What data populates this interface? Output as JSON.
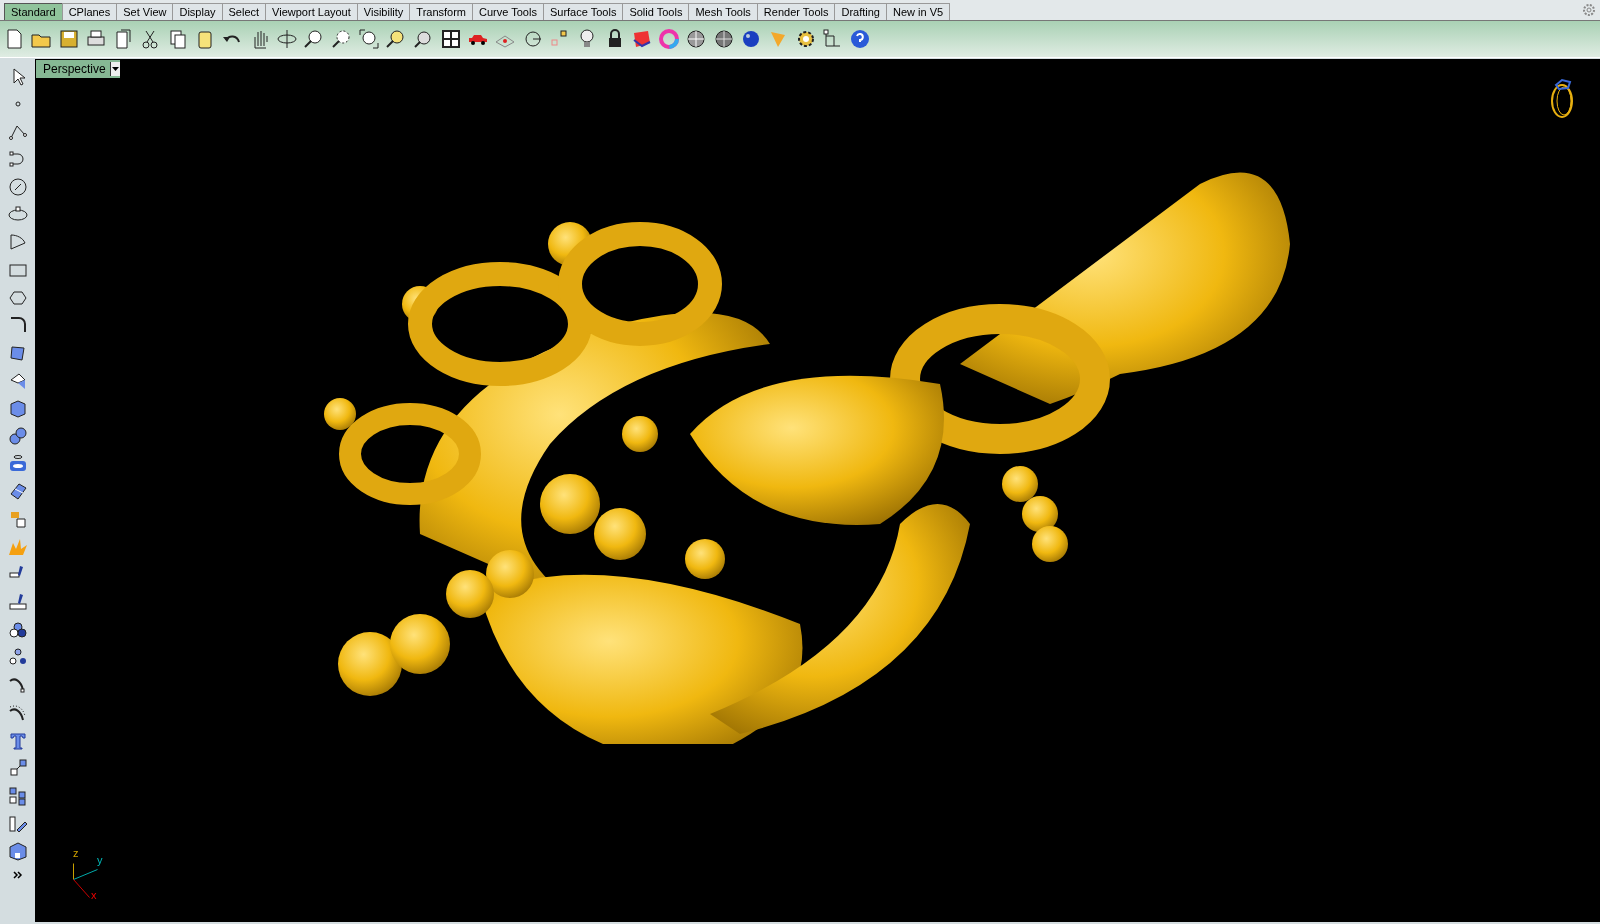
{
  "tabs": [
    {
      "label": "Standard",
      "selected": true
    },
    {
      "label": "CPlanes",
      "selected": false
    },
    {
      "label": "Set View",
      "selected": false
    },
    {
      "label": "Display",
      "selected": false
    },
    {
      "label": "Select",
      "selected": false
    },
    {
      "label": "Viewport Layout",
      "selected": false
    },
    {
      "label": "Visibility",
      "selected": false
    },
    {
      "label": "Transform",
      "selected": false
    },
    {
      "label": "Curve Tools",
      "selected": false
    },
    {
      "label": "Surface Tools",
      "selected": false
    },
    {
      "label": "Solid Tools",
      "selected": false
    },
    {
      "label": "Mesh Tools",
      "selected": false
    },
    {
      "label": "Render Tools",
      "selected": false
    },
    {
      "label": "Drafting",
      "selected": false
    },
    {
      "label": "New in V5",
      "selected": false
    }
  ],
  "viewport": {
    "title": "Perspective",
    "axes": {
      "z": "z",
      "y": "y",
      "x": "x"
    }
  }
}
